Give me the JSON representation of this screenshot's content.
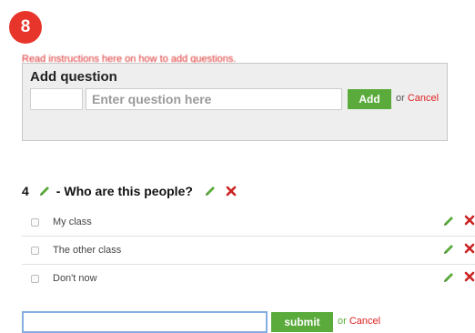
{
  "step_badge": "8",
  "help_link_text": "Read instructions here on how to add questions.",
  "add_question": {
    "title": "Add question",
    "placeholder": "Enter question here",
    "add_label": "Add",
    "or_text": "or",
    "cancel_label": "Cancel"
  },
  "question": {
    "number": "4",
    "text": "- Who are this people?",
    "answers": [
      {
        "label": "My class"
      },
      {
        "label": "The other class"
      },
      {
        "label": "Don't now"
      }
    ]
  },
  "new_answer": {
    "submit_label": "submit",
    "or_text": "or",
    "cancel_label": "Cancel"
  },
  "colors": {
    "accent_green": "#5aab3c",
    "delete_red": "#cc2222",
    "badge_red": "#e8352b",
    "input_focus_blue": "#84aee0"
  },
  "icons": {
    "edit": "pencil-icon",
    "delete": "x-icon"
  }
}
